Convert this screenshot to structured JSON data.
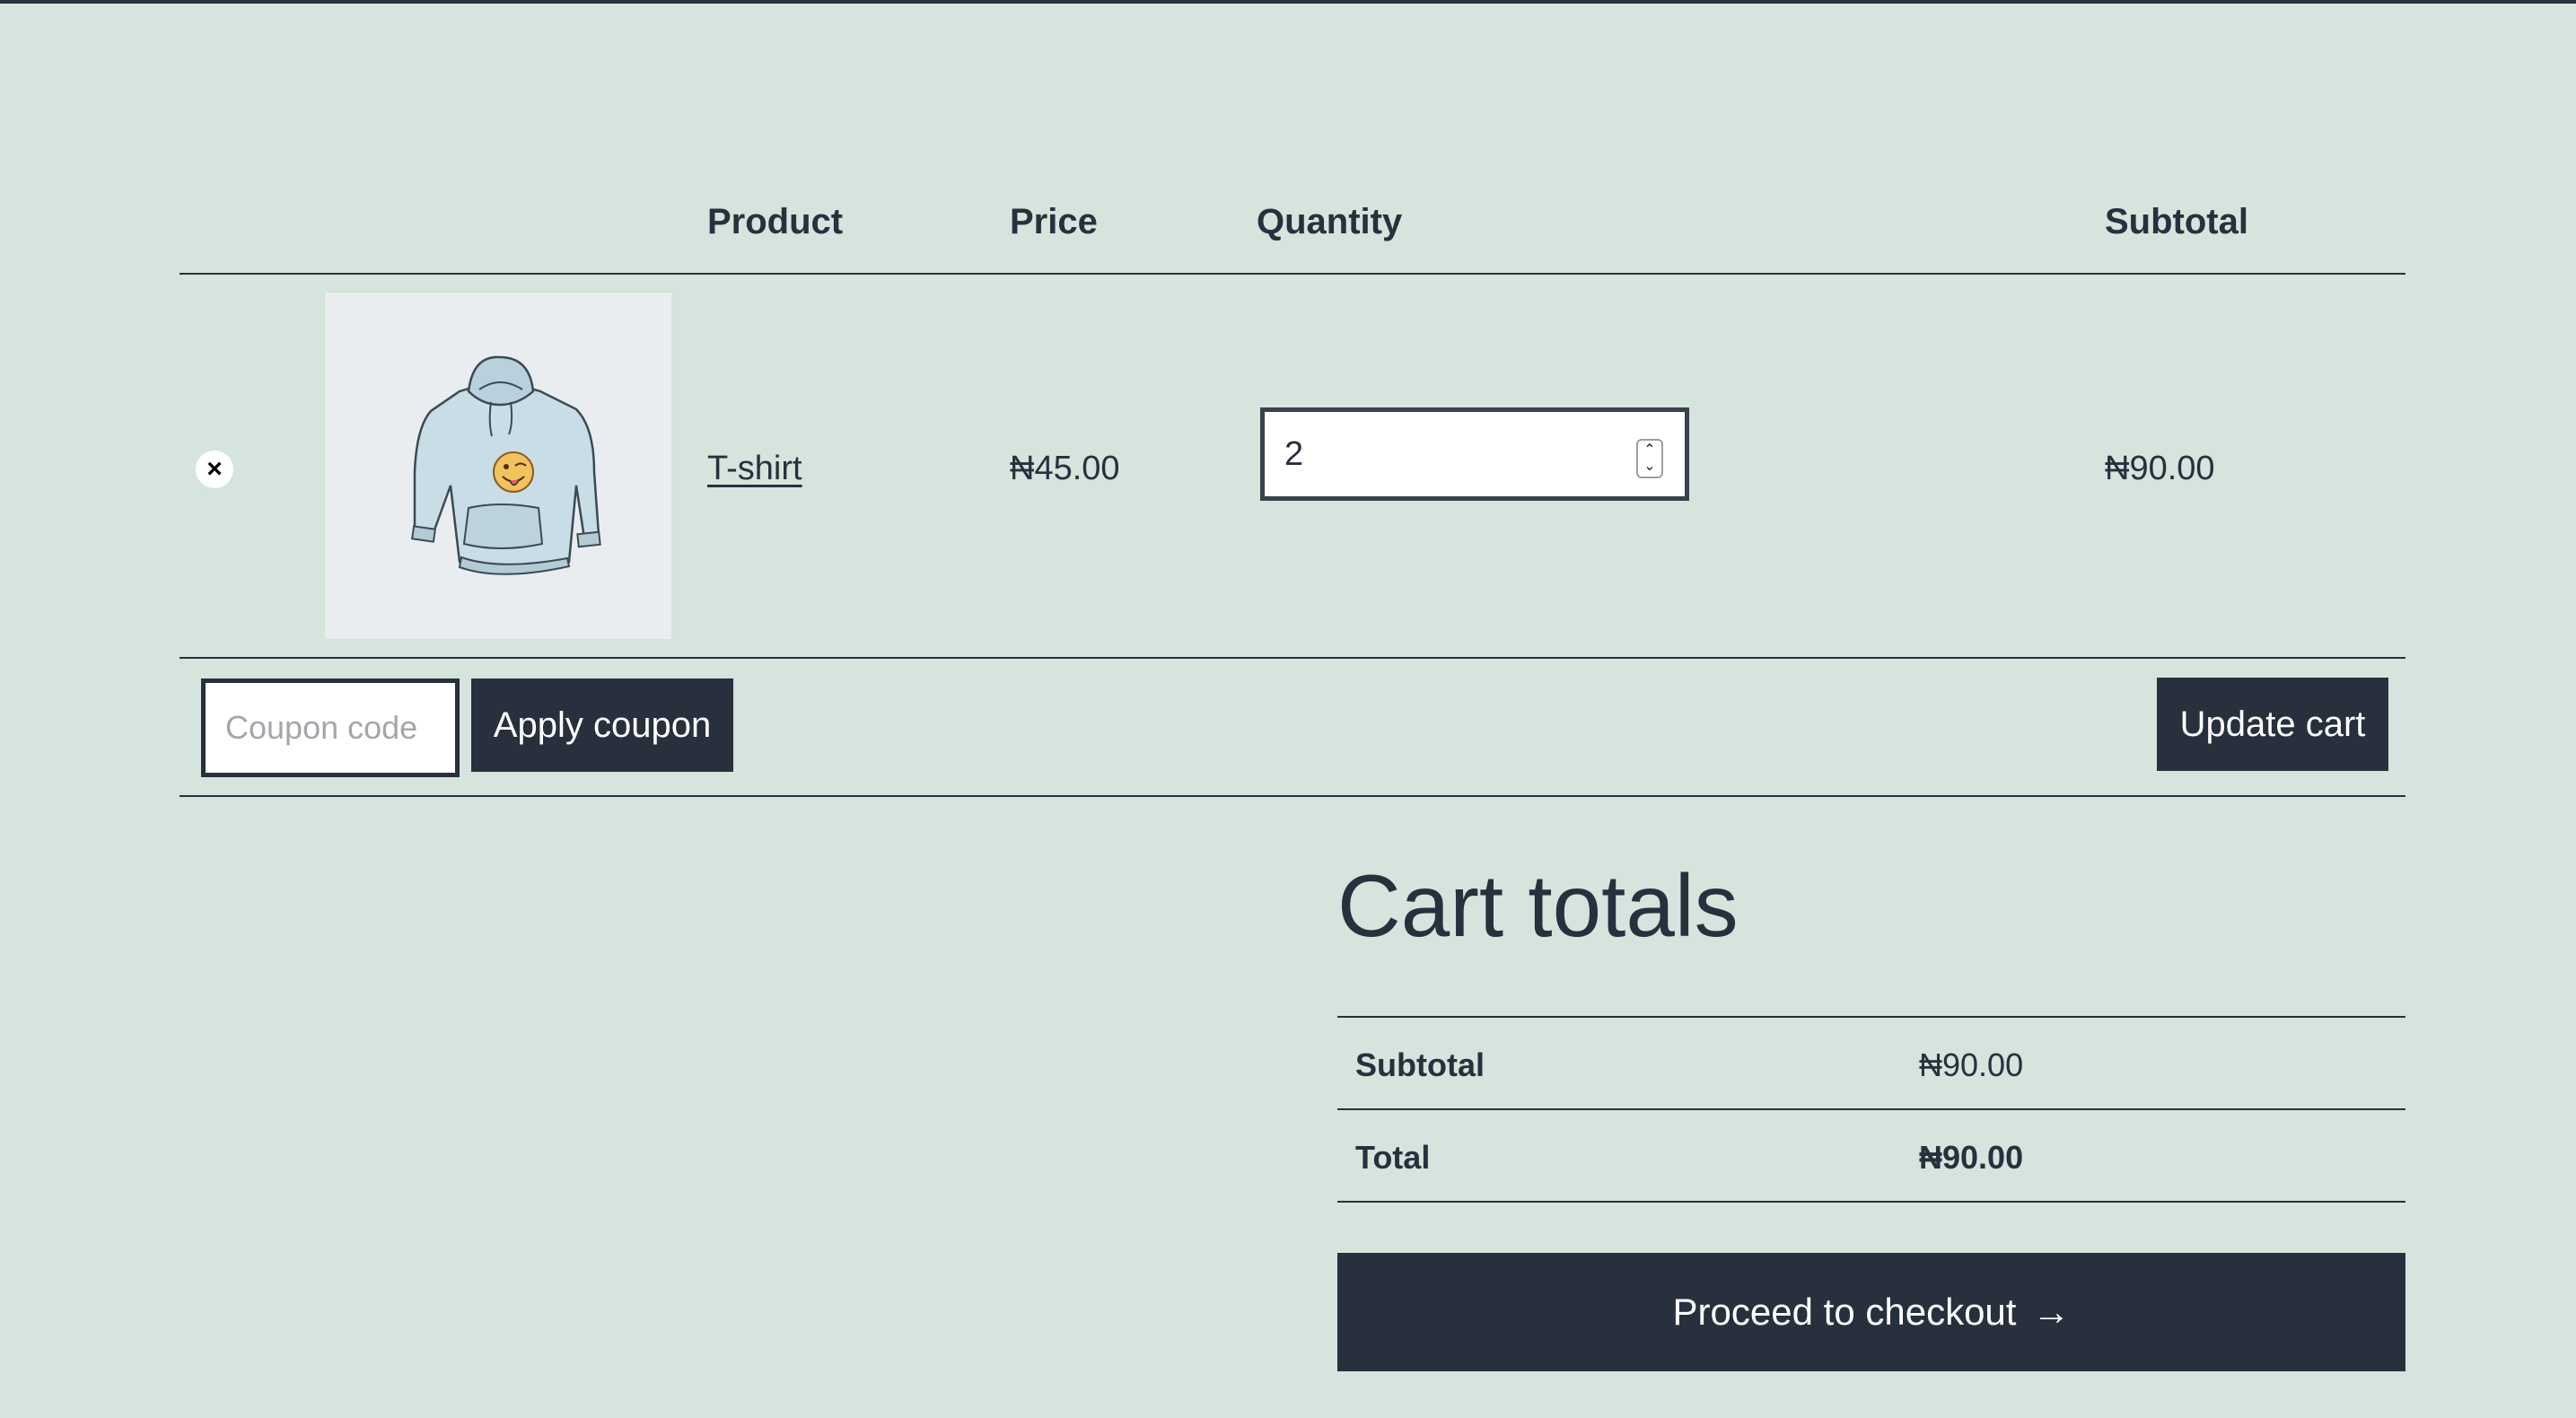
{
  "cart_table": {
    "headers": {
      "product": "Product",
      "price": "Price",
      "quantity": "Quantity",
      "subtotal": "Subtotal"
    },
    "items": [
      {
        "remove_icon": "×",
        "product_name": "T-shirt",
        "price": "₦45.00",
        "quantity": "2",
        "subtotal": "₦90.00",
        "image": "hoodie-with-winking-emoji-thumbnail"
      }
    ]
  },
  "actions": {
    "coupon_placeholder": "Coupon code",
    "apply_coupon_label": "Apply coupon",
    "update_cart_label": "Update cart"
  },
  "totals": {
    "title": "Cart totals",
    "rows": [
      {
        "label": "Subtotal",
        "value": "₦90.00"
      },
      {
        "label": "Total",
        "value": "₦90.00"
      }
    ],
    "checkout_label": "Proceed to checkout",
    "checkout_arrow": "→"
  },
  "colors": {
    "background": "#d5e4dd",
    "text": "#28303d",
    "button": "#28303d",
    "button_text": "#ffffff"
  }
}
